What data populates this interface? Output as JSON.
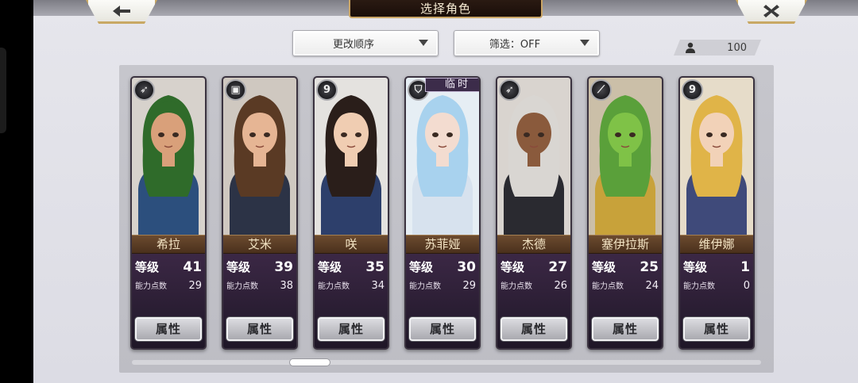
{
  "header": {
    "title": "选择角色",
    "back_icon": "back-arrow-icon",
    "close_icon": "close-x-icon"
  },
  "toolbar": {
    "sort_label": "更改顺序",
    "filter_label": "筛选：OFF",
    "character_count": "100"
  },
  "temp_badge_label": "临时",
  "stat_labels": {
    "level": "等级",
    "ability_points": "能力点数",
    "attributes_button": "属性"
  },
  "characters": [
    {
      "name": "希拉",
      "level": "41",
      "ability_points": "29",
      "class_icon": "bow-icon",
      "temporary": false,
      "colors": {
        "hair": "#2f6b2a",
        "skin": "#d9a07a",
        "outfit": "#2c4f7d"
      }
    },
    {
      "name": "艾米",
      "level": "39",
      "ability_points": "38",
      "class_icon": "gauntlet-icon",
      "temporary": false,
      "colors": {
        "hair": "#5a3a24",
        "skin": "#e6b594",
        "outfit": "#2c3346"
      }
    },
    {
      "name": "咲",
      "level": "35",
      "ability_points": "34",
      "class_icon": "staff-icon",
      "temporary": false,
      "colors": {
        "hair": "#2a1e1a",
        "skin": "#f0cdb2",
        "outfit": "#2d3f6b"
      }
    },
    {
      "name": "苏菲娅",
      "level": "30",
      "ability_points": "29",
      "class_icon": "shield-icon",
      "temporary": true,
      "colors": {
        "hair": "#a8d2ee",
        "skin": "#f3dcd0",
        "outfit": "#d7e2ee"
      }
    },
    {
      "name": "杰德",
      "level": "27",
      "ability_points": "26",
      "class_icon": "bow-icon",
      "temporary": false,
      "colors": {
        "hair": "#d9d6d2",
        "skin": "#8a5a3c",
        "outfit": "#2a2a30"
      }
    },
    {
      "name": "塞伊拉斯",
      "level": "25",
      "ability_points": "24",
      "class_icon": "sword-icon",
      "temporary": false,
      "colors": {
        "hair": "#5aa03a",
        "skin": "#7fc247",
        "outfit": "#c8a23a"
      }
    },
    {
      "name": "维伊娜",
      "level": "1",
      "ability_points": "0",
      "class_icon": "staff-icon",
      "temporary": false,
      "colors": {
        "hair": "#e0b448",
        "skin": "#f2d2b8",
        "outfit": "#3f4a7a"
      }
    }
  ]
}
